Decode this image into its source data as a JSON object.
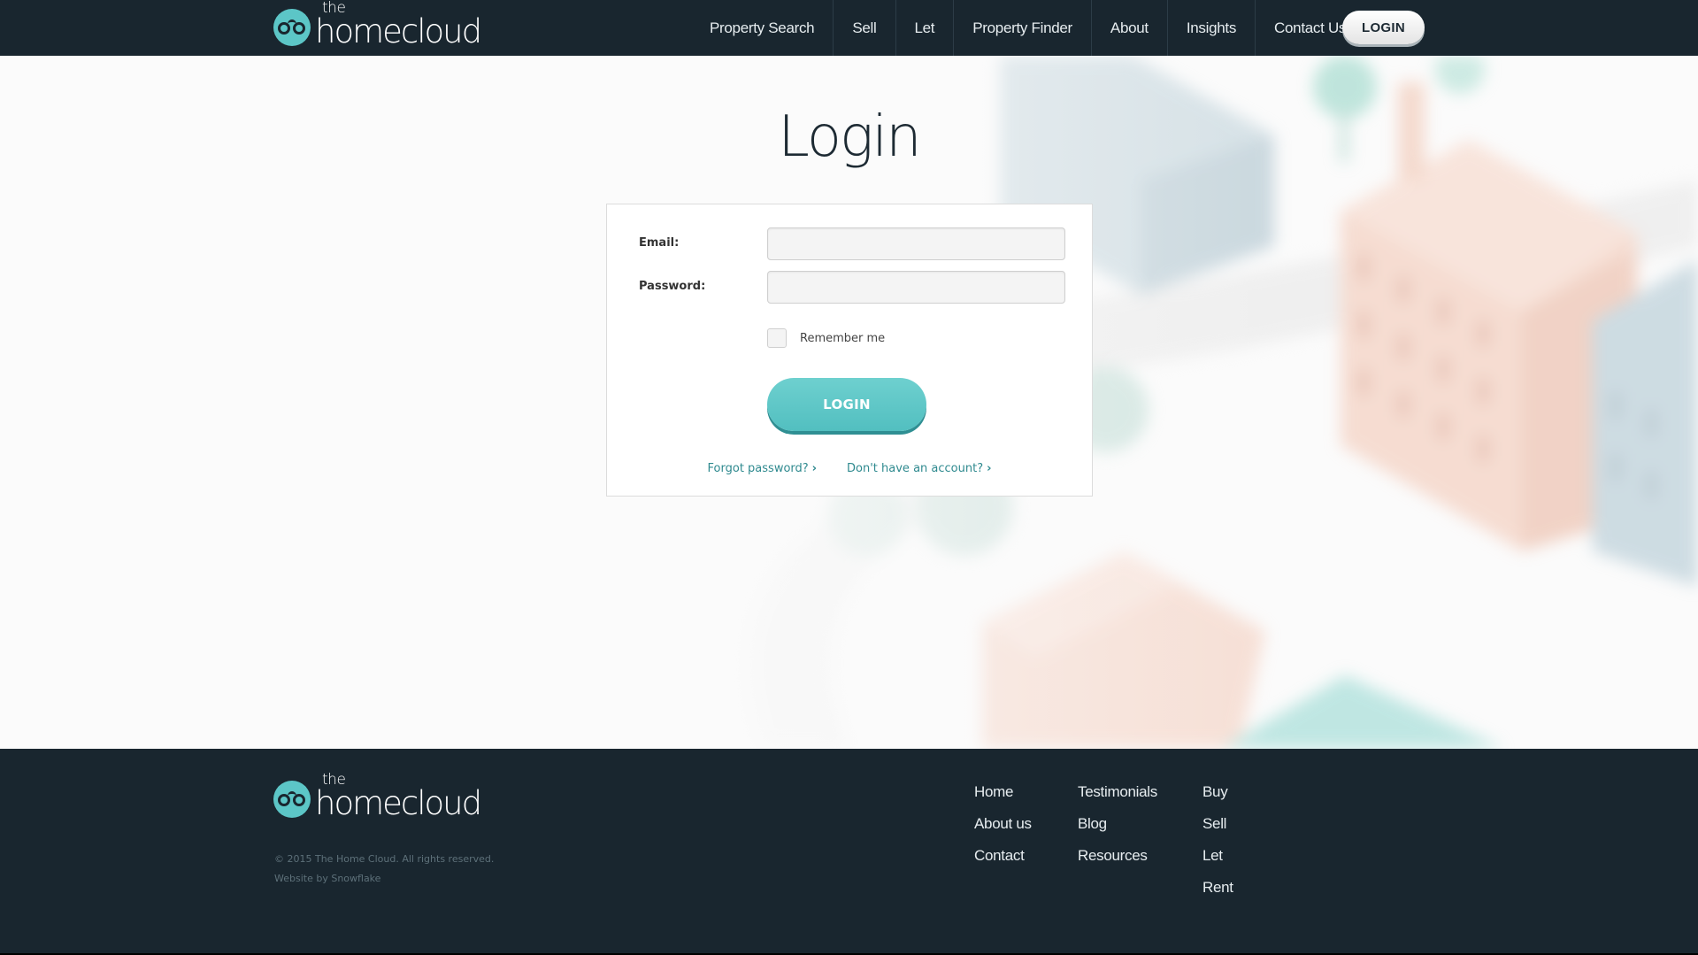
{
  "colors": {
    "header_bg": "#19262f",
    "accent": "#5cc6c7",
    "link": "#2f8a8f"
  },
  "brand": {
    "the": "the",
    "name": "homecloud"
  },
  "nav": {
    "items": [
      "Property Search",
      "Sell",
      "Let",
      "Property Finder",
      "About",
      "Insights",
      "Contact Us"
    ],
    "login_label": "LOGIN"
  },
  "page": {
    "title": "Login"
  },
  "form": {
    "email_label": "Email:",
    "email_value": "",
    "password_label": "Password:",
    "password_value": "",
    "remember_label": "Remember me",
    "submit_label": "LOGIN",
    "forgot_label": "Forgot password?",
    "signup_label": "Don't have an account?",
    "chevron": "›"
  },
  "footer": {
    "copyright": "© 2015 The Home Cloud. All rights reserved.",
    "credit": "Website by Snowflake",
    "col1": [
      "Home",
      "About us",
      "Contact"
    ],
    "col2": [
      "Testimonials",
      "Blog",
      "Resources"
    ],
    "col3": [
      "Buy",
      "Sell",
      "Let",
      "Rent"
    ]
  }
}
